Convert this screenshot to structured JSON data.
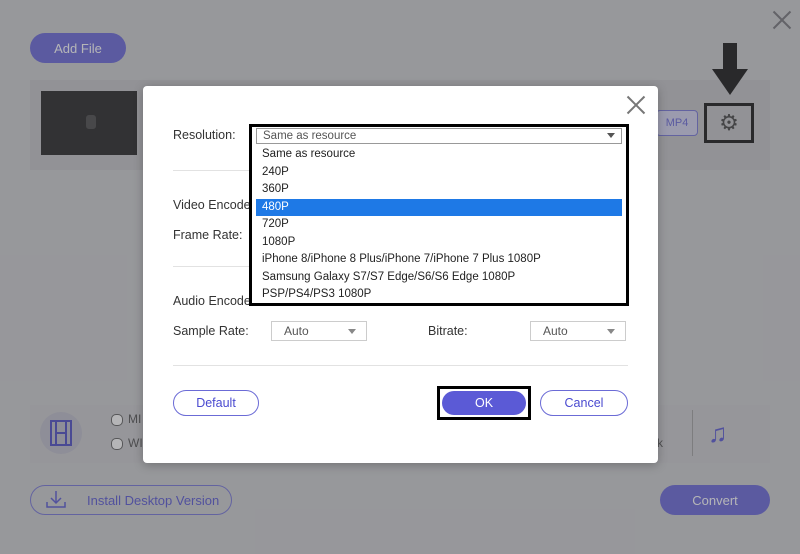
{
  "background": {
    "add_file_label": "Add File",
    "format_tag": "MP4",
    "radio_1_label": "MI",
    "radio_2_label": "WI",
    "trailing_k": "k",
    "install_label": "Install Desktop Version",
    "convert_label": "Convert"
  },
  "dialog": {
    "resolution_label": "Resolution:",
    "video_encoder_label": "Video Encode",
    "frame_rate_label": "Frame Rate:",
    "audio_encoder_label": "Audio Encode",
    "sample_rate_label": "Sample Rate:",
    "sample_rate_value": "Auto",
    "bitrate_label": "Bitrate:",
    "bitrate_value": "Auto",
    "default_label": "Default",
    "ok_label": "OK",
    "cancel_label": "Cancel"
  },
  "resolution_dropdown": {
    "selected": "Same as resource",
    "options": [
      "Same as resource",
      "240P",
      "360P",
      "480P",
      "720P",
      "1080P",
      "iPhone 8/iPhone 8 Plus/iPhone 7/iPhone 7 Plus 1080P",
      "Samsung Galaxy S7/S7 Edge/S6/S6 Edge 1080P",
      "PSP/PS4/PS3 1080P"
    ],
    "highlighted": "480P"
  },
  "colors": {
    "accent": "#5b5ad6",
    "highlight": "#1e79e6",
    "annotation": "#000000"
  }
}
